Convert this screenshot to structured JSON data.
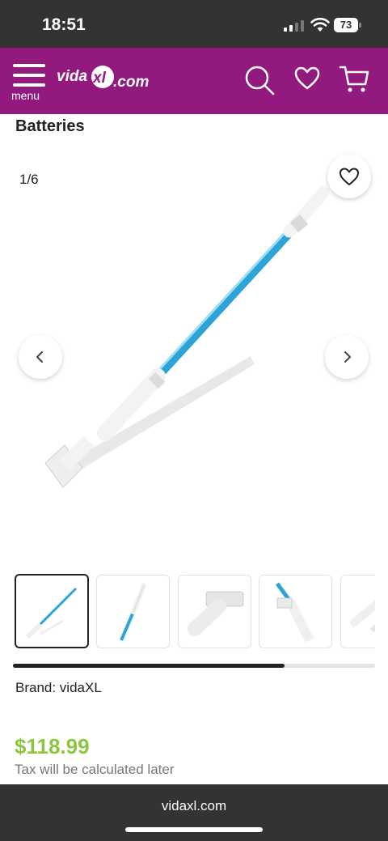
{
  "status_bar": {
    "time": "18:51",
    "battery": "73"
  },
  "nav": {
    "logo_text": "vidaXL.com",
    "menu_label": "menu",
    "color": "#921a7e"
  },
  "product": {
    "title": "Batteries",
    "image_counter": "1/6",
    "brand": "Brand: vidaXL",
    "price": "$118.99",
    "tax_note": "Tax will be calculated later",
    "gallery_progress": 0.75
  },
  "thumbnails": [
    "pool-vacuum-pole-full",
    "pole-detail",
    "vacuum-head",
    "pole-joint",
    "pole-end"
  ],
  "browser": {
    "url": "vidaxl.com"
  },
  "colors": {
    "accent_purple": "#921a7e",
    "price_green": "#8cc63f",
    "pole_blue": "#2ea3d6"
  }
}
